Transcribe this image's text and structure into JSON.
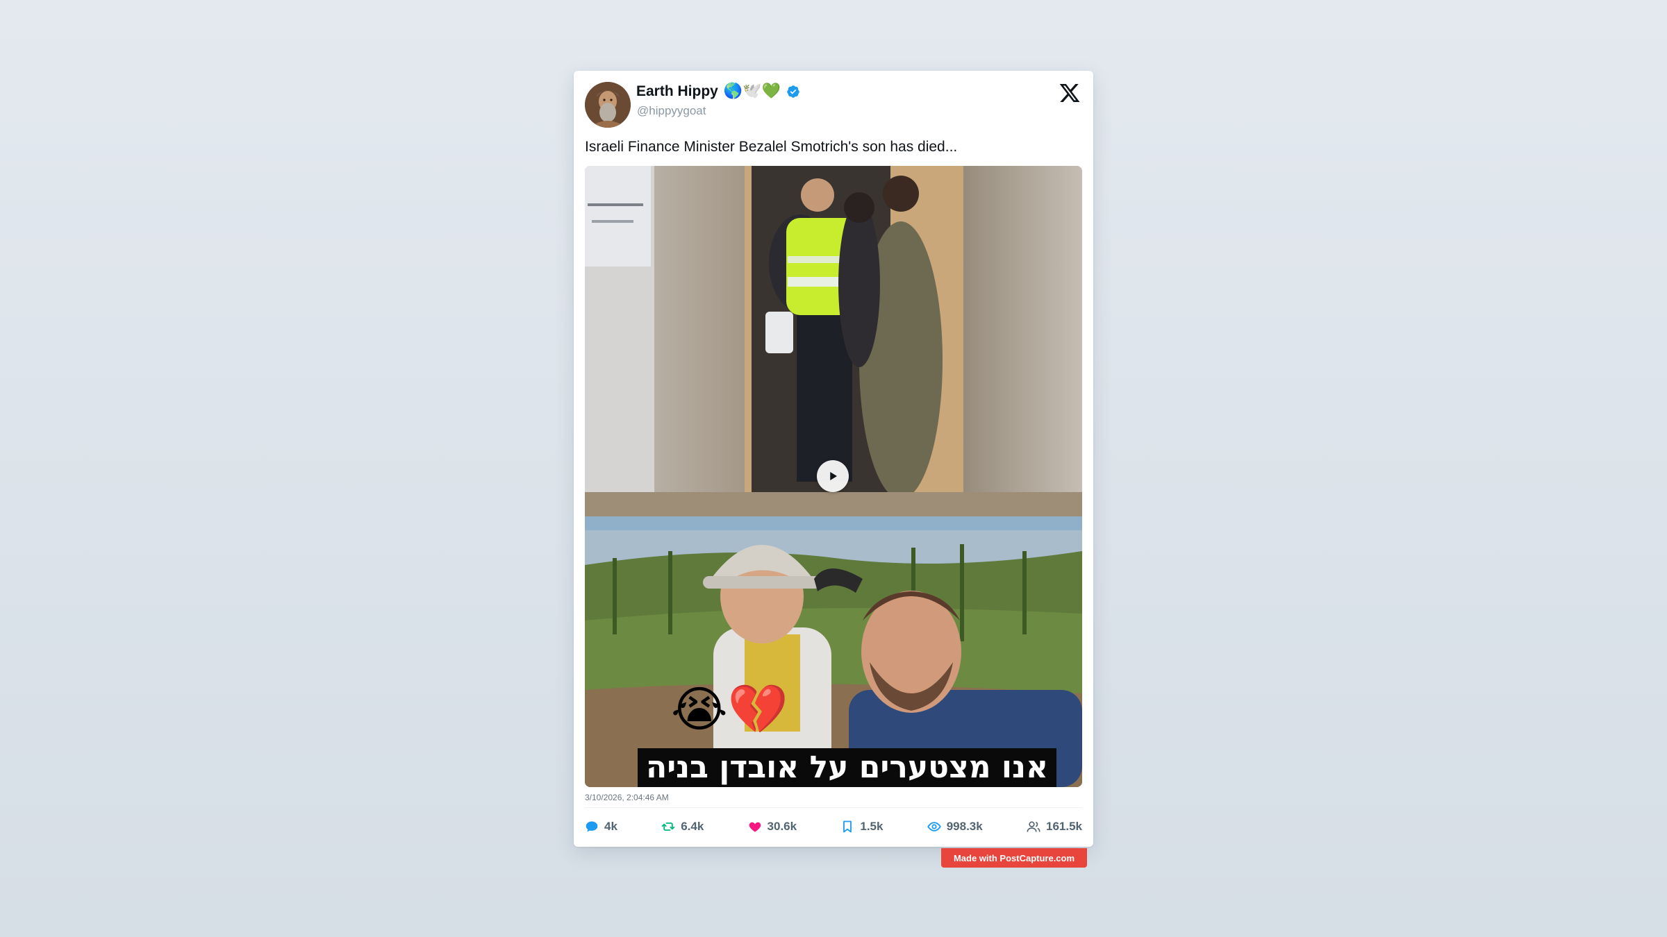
{
  "author": {
    "name": "Earth Hippy",
    "name_emojis": "🌎🕊️💚",
    "handle": "@hippyygoat",
    "verified": true
  },
  "post": {
    "text": "Israeli Finance Minister Bezalel Smotrich's son has died...",
    "timestamp": "3/10/2026, 2:04:46 AM"
  },
  "media": {
    "video_has_play_button": true,
    "image_caption": "אנו מצטערים על אובדן בניה",
    "image_emojis": "😭💔"
  },
  "stats": {
    "replies": "4k",
    "reposts": "6.4k",
    "likes": "30.6k",
    "bookmarks": "1.5k",
    "views": "998.3k",
    "followers": "161.5k"
  },
  "colors": {
    "reply": "#1d9bf0",
    "repost": "#00ba7c",
    "like": "#f91880",
    "bookmark": "#1d9bf0",
    "views": "#1d9bf0",
    "followers": "#536471",
    "watermark": "#e8453c"
  },
  "watermark": {
    "text": "Made with PostCapture.com"
  }
}
